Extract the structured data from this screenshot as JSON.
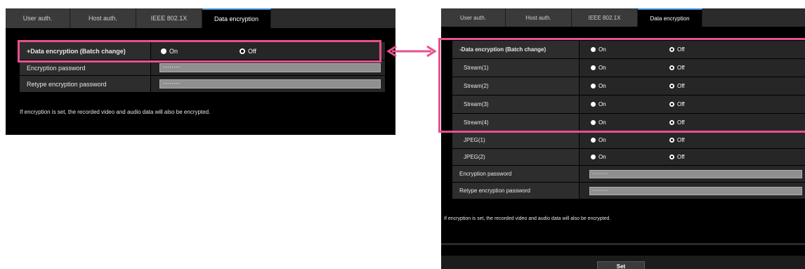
{
  "left_panel": {
    "tabs": [
      {
        "label": "User auth."
      },
      {
        "label": "Host auth."
      },
      {
        "label": "IEEE 802.1X"
      },
      {
        "label": "Data encryption"
      }
    ],
    "rows": {
      "batch": {
        "label": "+Data encryption (Batch change)",
        "on": "On",
        "off": "Off"
      },
      "password": {
        "label": "Encryption password",
        "value": "••••••••"
      },
      "retype": {
        "label": "Retype encryption password",
        "value": "••••••••"
      }
    },
    "note": "If encryption is set, the recorded video and audio data will also be encrypted."
  },
  "right_panel": {
    "tabs": [
      {
        "label": "User auth."
      },
      {
        "label": "Host auth."
      },
      {
        "label": "IEEE 802.1X"
      },
      {
        "label": "Data encryption"
      }
    ],
    "rows": [
      {
        "label": "-Data encryption (Batch change)",
        "on": "On",
        "off": "Off"
      },
      {
        "label": "Stream(1)",
        "on": "On",
        "off": "Off"
      },
      {
        "label": "Stream(2)",
        "on": "On",
        "off": "Off"
      },
      {
        "label": "Stream(3)",
        "on": "On",
        "off": "Off"
      },
      {
        "label": "Stream(4)",
        "on": "On",
        "off": "Off"
      },
      {
        "label": "JPEG(1)",
        "on": "On",
        "off": "Off"
      },
      {
        "label": "JPEG(2)",
        "on": "On",
        "off": "Off"
      }
    ],
    "password": {
      "label": "Encryption password",
      "value": "••••••••"
    },
    "retype": {
      "label": "Retype encryption password",
      "value": "••••••••"
    },
    "note": "If encryption is set, the recorded video and audio data will also be encrypted.",
    "set_label": "Set"
  },
  "colors": {
    "highlight": "#e8508f",
    "tab_active_border": "#3f8fd6"
  }
}
